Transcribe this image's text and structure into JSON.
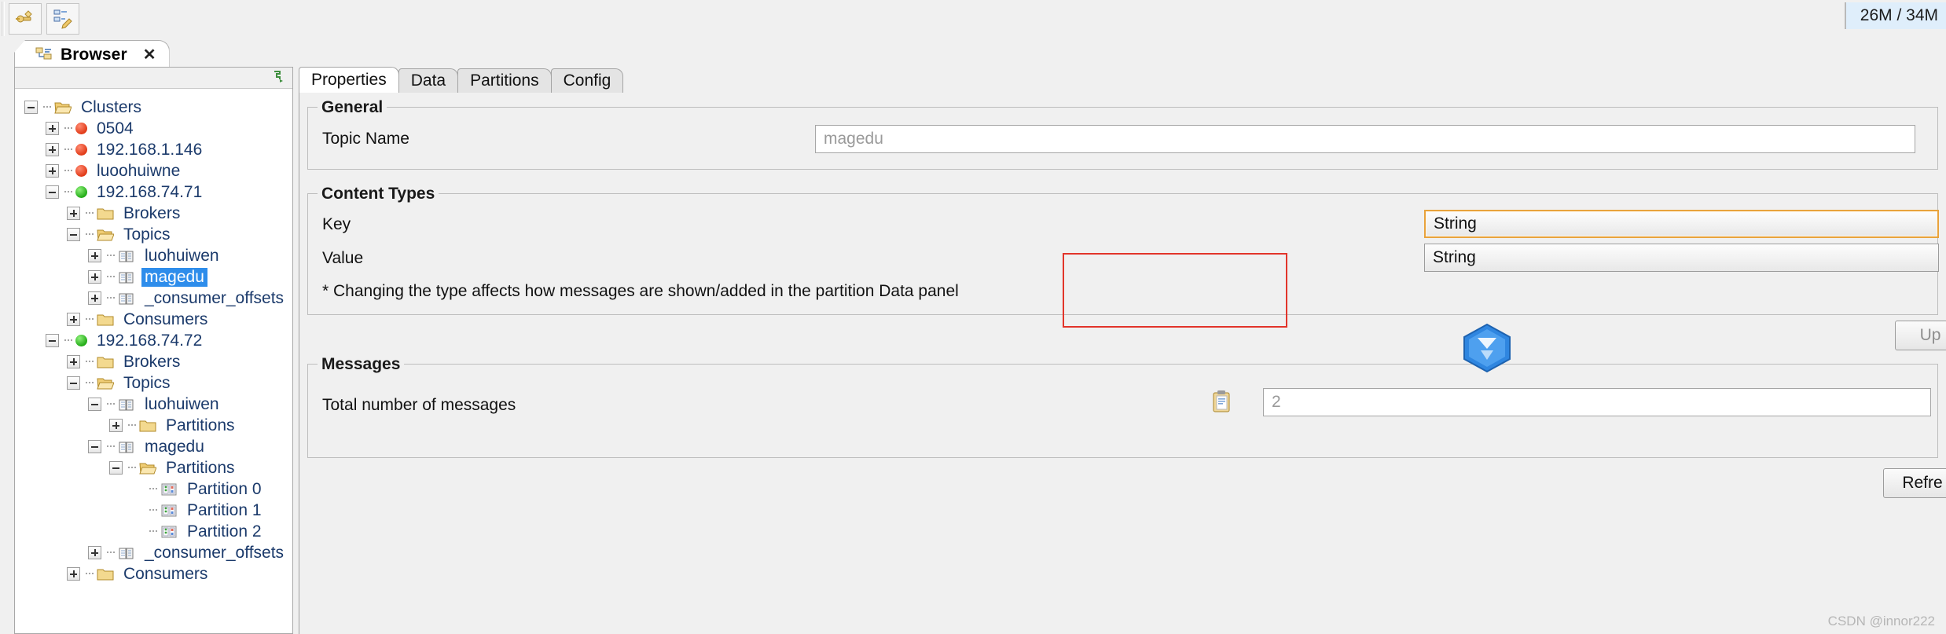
{
  "window": {
    "memory_indicator": "26M / 34M"
  },
  "toolbar": {
    "buttons": [
      {
        "name": "add-cluster-icon",
        "title": "Add Cluster"
      },
      {
        "name": "edit-cluster-icon",
        "title": "Edit Cluster"
      }
    ]
  },
  "view_tab": {
    "label": "Browser",
    "close": "✕",
    "icon": "browser-tree-icon"
  },
  "tree": {
    "nodes": [
      {
        "label": "Clusters",
        "indent": 0,
        "expander": "minus",
        "icon": "folder-open",
        "selected": false
      },
      {
        "label": "0504",
        "indent": 1,
        "expander": "plus",
        "icon": "dot-red",
        "selected": false
      },
      {
        "label": "192.168.1.146",
        "indent": 1,
        "expander": "plus",
        "icon": "dot-red",
        "selected": false
      },
      {
        "label": "luoohuiwne",
        "indent": 1,
        "expander": "plus",
        "icon": "dot-red",
        "selected": false
      },
      {
        "label": "192.168.74.71",
        "indent": 1,
        "expander": "minus",
        "icon": "dot-green",
        "selected": false
      },
      {
        "label": "Brokers",
        "indent": 2,
        "expander": "plus",
        "icon": "folder",
        "selected": false
      },
      {
        "label": "Topics",
        "indent": 2,
        "expander": "minus",
        "icon": "folder-open",
        "selected": false
      },
      {
        "label": "luohuiwen",
        "indent": 3,
        "expander": "plus",
        "icon": "topic",
        "selected": false
      },
      {
        "label": "magedu",
        "indent": 3,
        "expander": "plus",
        "icon": "topic",
        "selected": true
      },
      {
        "label": "_consumer_offsets",
        "indent": 3,
        "expander": "plus",
        "icon": "topic",
        "selected": false
      },
      {
        "label": "Consumers",
        "indent": 2,
        "expander": "plus",
        "icon": "folder",
        "selected": false
      },
      {
        "label": "192.168.74.72",
        "indent": 1,
        "expander": "minus",
        "icon": "dot-green",
        "selected": false
      },
      {
        "label": "Brokers",
        "indent": 2,
        "expander": "plus",
        "icon": "folder",
        "selected": false
      },
      {
        "label": "Topics",
        "indent": 2,
        "expander": "minus",
        "icon": "folder-open",
        "selected": false
      },
      {
        "label": "luohuiwen",
        "indent": 3,
        "expander": "minus",
        "icon": "topic",
        "selected": false
      },
      {
        "label": "Partitions",
        "indent": 4,
        "expander": "plus",
        "icon": "folder",
        "selected": false
      },
      {
        "label": "magedu",
        "indent": 3,
        "expander": "minus",
        "icon": "topic",
        "selected": false
      },
      {
        "label": "Partitions",
        "indent": 4,
        "expander": "minus",
        "icon": "folder-open",
        "selected": false
      },
      {
        "label": "Partition 0",
        "indent": 5,
        "expander": "none",
        "icon": "partition",
        "selected": false
      },
      {
        "label": "Partition 1",
        "indent": 5,
        "expander": "none",
        "icon": "partition",
        "selected": false
      },
      {
        "label": "Partition 2",
        "indent": 5,
        "expander": "none",
        "icon": "partition",
        "selected": false
      },
      {
        "label": "_consumer_offsets",
        "indent": 3,
        "expander": "plus",
        "icon": "topic",
        "selected": false
      },
      {
        "label": "Consumers",
        "indent": 2,
        "expander": "plus",
        "icon": "folder",
        "selected": false
      }
    ]
  },
  "editor": {
    "tabs": [
      {
        "label": "Properties",
        "active": true
      },
      {
        "label": "Data",
        "active": false
      },
      {
        "label": "Partitions",
        "active": false
      },
      {
        "label": "Config",
        "active": false
      }
    ],
    "general": {
      "legend": "General",
      "topic_name_label": "Topic Name",
      "topic_name_value": "magedu"
    },
    "content_types": {
      "legend": "Content Types",
      "key_label": "Key",
      "key_value": "String",
      "value_label": "Value",
      "value_value": "String",
      "note": "* Changing the type affects how messages are shown/added in the partition Data panel",
      "update_button": "Up",
      "highlight_color": "#e2342a",
      "focus_color": "#e8a33d"
    },
    "messages": {
      "legend": "Messages",
      "total_label": "Total number of messages",
      "total_value": "2",
      "copy_icon": "clipboard-icon",
      "refresh_button": "Refre"
    }
  },
  "watermark": "CSDN @innor222"
}
